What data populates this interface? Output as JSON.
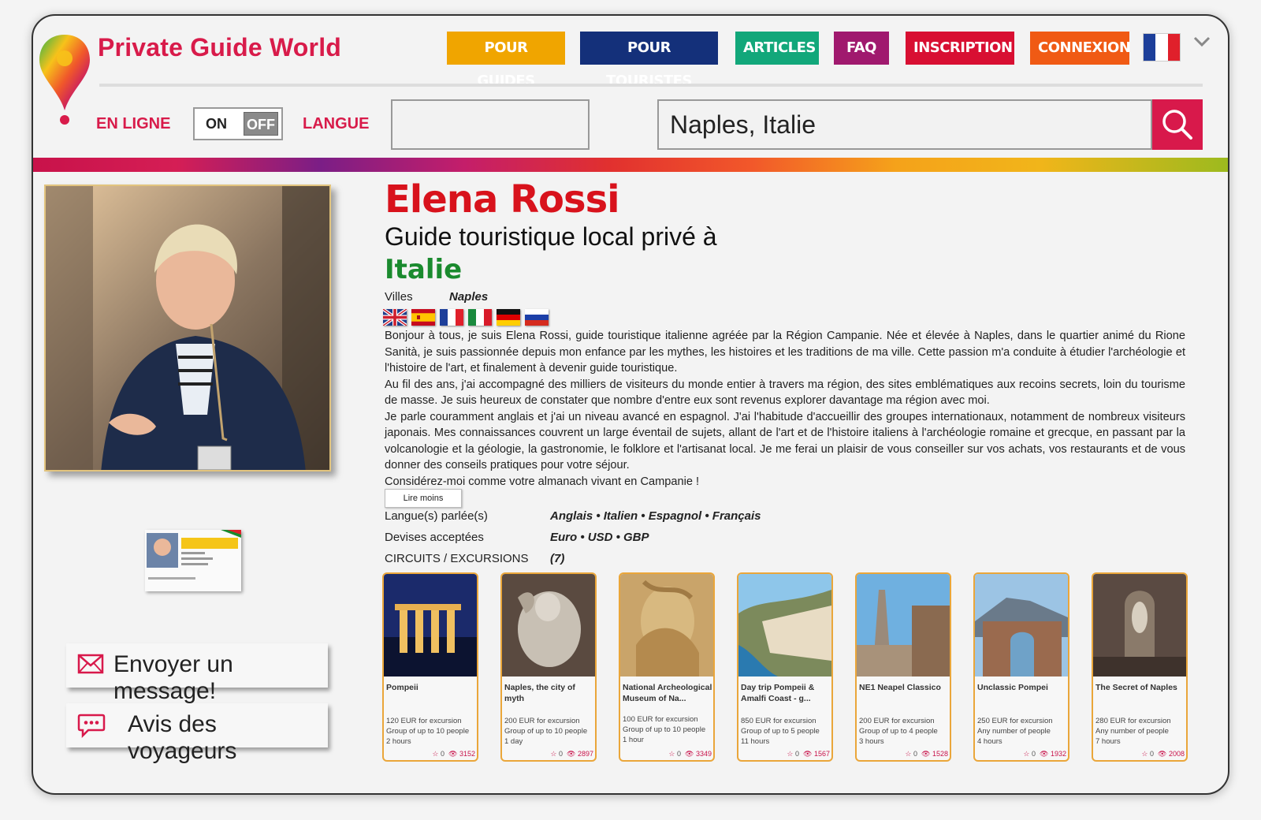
{
  "brand": "Private Guide World",
  "nav": {
    "guides": "POUR GUIDES",
    "tourists": "POUR TOURISTES",
    "articles": "ARTICLES",
    "faq": "FAQ",
    "signup": "INSCRIPTION",
    "login": "CONNEXION"
  },
  "filters": {
    "online_label": "EN LIGNE",
    "toggle_on": "ON",
    "toggle_off": "OFF",
    "language_label": "LANGUE",
    "language_value": "",
    "search_value": "Naples, Italie"
  },
  "sidebar": {
    "message_button": "Envoyer un message!",
    "reviews_button": "Avis des voyageurs"
  },
  "profile": {
    "name": "Elena Rossi",
    "subtitle": "Guide touristique local privé à",
    "country": "Italie",
    "cities_label": "Villes",
    "cities_value": "Naples",
    "flags": [
      "uk-flag",
      "spain-flag",
      "france-flag",
      "italy-flag",
      "germany-flag",
      "russia-flag"
    ],
    "bio": [
      "Bonjour à tous, je suis Elena Rossi, guide touristique italienne agréée par la Région Campanie. Née et élevée à Naples, dans le quartier animé du Rione Sanità, je suis passionnée depuis mon enfance par les mythes, les histoires et les traditions de ma ville. Cette passion m'a conduite à étudier l'archéologie et l'histoire de l'art, et finalement à devenir guide touristique.",
      "Au fil des ans, j'ai accompagné des milliers de visiteurs du monde entier à travers ma région, des sites emblématiques aux recoins secrets, loin du tourisme de masse. Je suis heureux de constater que nombre d'entre eux sont revenus explorer davantage ma région avec moi.",
      "Je parle couramment anglais et j'ai un niveau avancé en espagnol. J'ai l'habitude d'accueillir des groupes internationaux, notamment de nombreux visiteurs japonais. Mes connaissances couvrent un large éventail de sujets, allant de l'art et de l'histoire italiens à l'archéologie romaine et grecque, en passant par la volcanologie et la géologie, la gastronomie, le folklore et l'artisanat local. Je me ferai un plaisir de vous conseiller sur vos achats, vos restaurants et de vous donner des conseils pratiques pour votre séjour.",
      "Considérez-moi comme votre almanach vivant en Campanie !"
    ],
    "read_less": "Lire moins",
    "languages_label": "Langue(s) parlée(s)",
    "languages_value": "Anglais • Italien • Espagnol • Français",
    "currencies_label": "Devises acceptées",
    "currencies_value": "Euro • USD • GBP",
    "tours_label": "CIRCUITS / EXCURSIONS",
    "tours_count": "(7)"
  },
  "tours": [
    {
      "title": "Pompeii",
      "price": "120 EUR for excursion",
      "group": "Group of up to 10 people",
      "duration": "2 hours",
      "stars": "0",
      "views": "3152"
    },
    {
      "title": "Naples, the city of myth",
      "price": "200 EUR for excursion",
      "group": "Group of up to 10 people",
      "duration": "1 day",
      "stars": "0",
      "views": "2897"
    },
    {
      "title": "National Archeological Museum of Na...",
      "price": "100 EUR for excursion",
      "group": "Group of up to 10 people",
      "duration": "1 hour",
      "stars": "0",
      "views": "3349"
    },
    {
      "title": "Day trip Pompeii & Amalfi Coast - g...",
      "price": "850 EUR for excursion",
      "group": "Group of up to 5 people",
      "duration": "11 hours",
      "stars": "0",
      "views": "1567"
    },
    {
      "title": "NE1 Neapel Classico",
      "price": "200 EUR for excursion",
      "group": "Group of up to 4 people",
      "duration": "3 hours",
      "stars": "0",
      "views": "1528"
    },
    {
      "title": "Unclassic Pompei",
      "price": "250 EUR for excursion",
      "group": "Any number of people",
      "duration": "4 hours",
      "stars": "0",
      "views": "1932"
    },
    {
      "title": "The Secret of Naples",
      "price": "280 EUR for excursion",
      "group": "Any number of people",
      "duration": "7 hours",
      "stars": "0",
      "views": "2008"
    }
  ],
  "colors": {
    "brand_red": "#d81b4a",
    "country_green": "#1a8a2e",
    "card_border": "#eaa63a"
  }
}
